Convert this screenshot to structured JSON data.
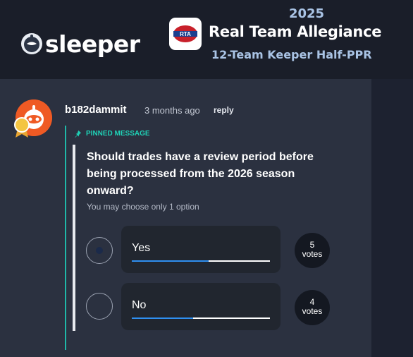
{
  "header": {
    "brand": "sleeper",
    "league_logo_text": "RTA",
    "year": "2025",
    "league_name": "Real Team Allegiance",
    "league_subtitle": "12-Team Keeper Half-PPR"
  },
  "message": {
    "username": "b182dammit",
    "timestamp": "3 months ago",
    "reply_label": "reply",
    "pinned_label": "PINNED MESSAGE",
    "question": "Should trades have a review period before being processed from the 2026 season onward?",
    "hint": "You may choose only 1 option",
    "options": [
      {
        "label": "Yes",
        "votes": "5",
        "votes_label": "votes",
        "fraction": 0.5556,
        "selected": true
      },
      {
        "label": "No",
        "votes": "4",
        "votes_label": "votes",
        "fraction": 0.4444,
        "selected": false
      }
    ]
  },
  "colors": {
    "accent_teal": "#1fd1b6",
    "progress_blue": "#2f8ff0",
    "avatar_orange": "#ef5a24",
    "panel_bg": "#2b3140"
  }
}
